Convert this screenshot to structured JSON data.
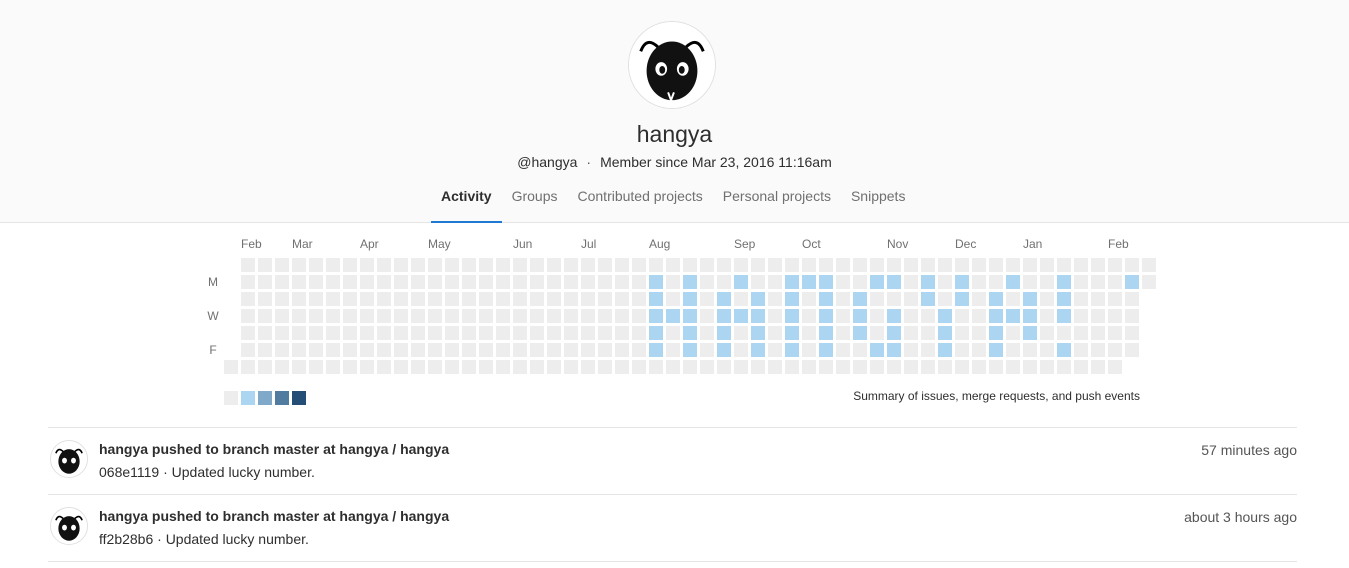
{
  "profile": {
    "name": "hangya",
    "username": "@hangya",
    "member_since": "Member since Mar 23, 2016 11:16am"
  },
  "tabs": [
    {
      "label": "Activity",
      "active": true
    },
    {
      "label": "Groups",
      "active": false
    },
    {
      "label": "Contributed projects",
      "active": false
    },
    {
      "label": "Personal projects",
      "active": false
    },
    {
      "label": "Snippets",
      "active": false
    }
  ],
  "calendar": {
    "months": [
      "Feb",
      "Mar",
      "Apr",
      "May",
      "Jun",
      "Jul",
      "Aug",
      "Sep",
      "Oct",
      "Nov",
      "Dec",
      "Jan",
      "Feb"
    ],
    "day_labels": [
      "M",
      "W",
      "F"
    ],
    "colors": {
      "empty": "#ededed",
      "l1": "#acd5f2",
      "l2": "#7fa8c9",
      "l3": "#527ba0",
      "l4": "#254e77"
    },
    "summary": "Summary of issues, merge requests, and push events"
  },
  "events": [
    {
      "actor": "hangya",
      "action": "pushed to branch",
      "branch": "master",
      "at": "at",
      "project": "hangya / hangya",
      "commit": "068e1119",
      "message": "· Updated lucky number.",
      "time": "57 minutes ago"
    },
    {
      "actor": "hangya",
      "action": "pushed to branch",
      "branch": "master",
      "at": "at",
      "project": "hangya / hangya",
      "commit": "ff2b28b6",
      "message": "· Updated lucky number.",
      "time": "about 3 hours ago"
    }
  ]
}
